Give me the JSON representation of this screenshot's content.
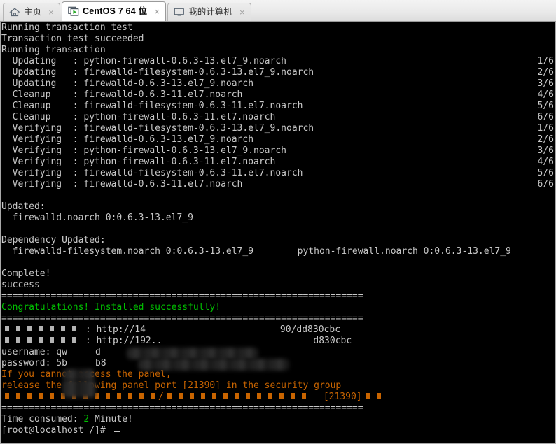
{
  "window": {
    "tabs": [
      {
        "label": "主页",
        "icon": "home-icon",
        "active": false,
        "close": "×"
      },
      {
        "label": "CentOS 7 64 位",
        "icon": "vm-console-icon",
        "active": true,
        "close": "×"
      },
      {
        "label": "我的计算机",
        "icon": "monitor-icon",
        "active": false,
        "close": "×"
      }
    ]
  },
  "terminal": {
    "colors": {
      "background": "#000000",
      "foreground": "#c8c8c8",
      "green": "#00c000",
      "orange": "#c86400"
    },
    "lines": [
      {
        "text": "Running transaction test"
      },
      {
        "text": "Transaction test succeeded"
      },
      {
        "text": "Running transaction"
      },
      {
        "text": "  Updating   : python-firewall-0.6.3-13.el7_9.noarch",
        "right": "1/6"
      },
      {
        "text": "  Updating   : firewalld-filesystem-0.6.3-13.el7_9.noarch",
        "right": "2/6"
      },
      {
        "text": "  Updating   : firewalld-0.6.3-13.el7_9.noarch",
        "right": "3/6"
      },
      {
        "text": "  Cleanup    : firewalld-0.6.3-11.el7.noarch",
        "right": "4/6"
      },
      {
        "text": "  Cleanup    : firewalld-filesystem-0.6.3-11.el7.noarch",
        "right": "5/6"
      },
      {
        "text": "  Cleanup    : python-firewall-0.6.3-11.el7.noarch",
        "right": "6/6"
      },
      {
        "text": "  Verifying  : firewalld-filesystem-0.6.3-13.el7_9.noarch",
        "right": "1/6"
      },
      {
        "text": "  Verifying  : firewalld-0.6.3-13.el7_9.noarch",
        "right": "2/6"
      },
      {
        "text": "  Verifying  : python-firewall-0.6.3-13.el7_9.noarch",
        "right": "3/6"
      },
      {
        "text": "  Verifying  : python-firewall-0.6.3-11.el7.noarch",
        "right": "4/6"
      },
      {
        "text": "  Verifying  : firewalld-filesystem-0.6.3-11.el7.noarch",
        "right": "5/6"
      },
      {
        "text": "  Verifying  : firewalld-0.6.3-11.el7.noarch",
        "right": "6/6"
      },
      {
        "text": ""
      },
      {
        "text": "Updated:"
      },
      {
        "text": "  firewalld.noarch 0:0.6.3-13.el7_9"
      },
      {
        "text": ""
      },
      {
        "text": "Dependency Updated:"
      },
      {
        "text": "  firewalld-filesystem.noarch 0:0.6.3-13.el7_9        python-firewall.noarch 0:0.6.3-13.el7_9"
      },
      {
        "text": ""
      },
      {
        "text": "Complete!"
      },
      {
        "text": "success"
      }
    ],
    "separator": "==================================================================",
    "congrats": "Congratulations! Installed successfully!",
    "url_line_1_prefix_boxes": 7,
    "url_line_1": " : http://14",
    "url_line_1_tail": "90/dd830cbc",
    "url_line_2_prefix_boxes": 7,
    "url_line_2": " : http://192..",
    "url_line_2_tail": "d830cbc",
    "username_label": "username: ",
    "username_head": "qw",
    "username_tail": "d",
    "password_label": "password: ",
    "password_head": "5b",
    "password_tail": "b8",
    "warn_line_1": "If you cannot access the panel,",
    "warn_line_2": "release the following panel port [21390] in the security group",
    "warn_boxes_before_slash": 14,
    "warn_slash": "/",
    "warn_boxes_after_slash": 13,
    "warn_port": "[21390]",
    "warn_boxes_tail": 2,
    "time_label": "Time consumed: ",
    "time_value": "2",
    "time_suffix": " Minute!",
    "prompt": "[root@localhost /]# "
  }
}
